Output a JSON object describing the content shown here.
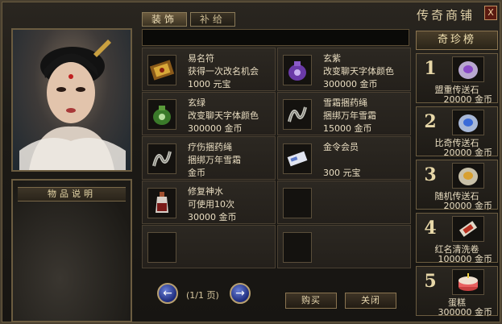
{
  "window": {
    "title": "传奇商铺",
    "close_label": "X"
  },
  "tabs": [
    {
      "label": "装饰"
    },
    {
      "label": "补给"
    }
  ],
  "description_panel": {
    "title": "物品说明"
  },
  "items": [
    {
      "name": "易名符",
      "desc": "获得一次改名机会",
      "price": "1000 元宝",
      "icon": "scroll-icon"
    },
    {
      "name": "玄紫",
      "desc": "改变聊天字体颜色",
      "price": "300000 金币",
      "icon": "purple-pouch-icon"
    },
    {
      "name": "玄绿",
      "desc": "改变聊天字体颜色",
      "price": "300000 金币",
      "icon": "green-pouch-icon"
    },
    {
      "name": "雪霜捆药绳",
      "desc": "捆绑万年雪霜",
      "price": "15000 金币",
      "icon": "rope-icon"
    },
    {
      "name": "疗伤捆药绳",
      "desc": "捆绑万年雪霜",
      "price": "金币",
      "icon": "rope-icon"
    },
    {
      "name": "金令会员",
      "desc": "",
      "price": "300 元宝",
      "icon": "membership-card-icon"
    },
    {
      "name": "修复神水",
      "desc": "可使用10次",
      "price": "30000 金币",
      "icon": "potion-bottle-icon"
    },
    {
      "name": "",
      "desc": "",
      "price": "",
      "icon": ""
    },
    {
      "name": "",
      "desc": "",
      "price": "",
      "icon": ""
    },
    {
      "name": "",
      "desc": "",
      "price": "",
      "icon": ""
    }
  ],
  "pager": {
    "text": "(1/1 页)",
    "prev_label": "←",
    "next_label": "→"
  },
  "buttons": {
    "buy": "购买",
    "close": "关闭"
  },
  "ranking": {
    "title": "奇珍榜",
    "entries": [
      {
        "rank": "1",
        "name": "盟重传送石",
        "price": "20000 金币",
        "icon": "purple-stone-icon"
      },
      {
        "rank": "2",
        "name": "比奇传送石",
        "price": "20000 金币",
        "icon": "blue-stone-icon"
      },
      {
        "rank": "3",
        "name": "随机传送石",
        "price": "20000 金币",
        "icon": "gold-stone-icon"
      },
      {
        "rank": "4",
        "name": "红名清洗卷",
        "price": "100000 金币",
        "icon": "red-scroll-icon"
      },
      {
        "rank": "5",
        "name": "蛋糕",
        "price": "300000 金币",
        "icon": "cake-icon"
      }
    ]
  },
  "colors": {
    "gold_text": "#e8dcc0",
    "frame": "#6b5c40",
    "button_blue": "#1c2a7a"
  }
}
